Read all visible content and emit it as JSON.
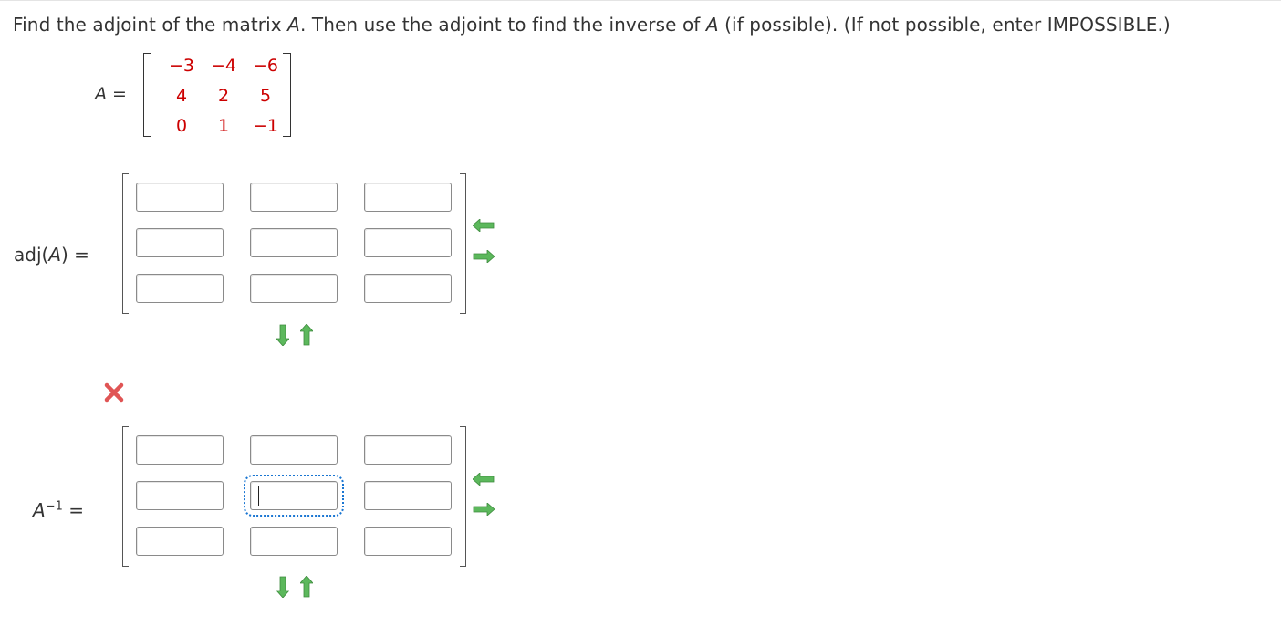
{
  "question": {
    "part1": "Find the adjoint of the matrix ",
    "var": "A",
    "part2": ". Then use the adjoint to find the inverse of ",
    "var2": "A",
    "part3": " (if possible). (If not possible, enter IMPOSSIBLE.)"
  },
  "given_matrix": {
    "label_var": "A",
    "label_eq": " =",
    "rows": [
      [
        "−3",
        "−4",
        "−6"
      ],
      [
        "4",
        "2",
        "5"
      ],
      [
        "0",
        "1",
        "−1"
      ]
    ]
  },
  "adjoint": {
    "label_pre": "adj(",
    "label_var": "A",
    "label_post": ") =",
    "cells": [
      [
        "",
        "",
        ""
      ],
      [
        "",
        "",
        ""
      ],
      [
        "",
        "",
        ""
      ]
    ]
  },
  "inverse": {
    "label_var": "A",
    "label_sup": "−1",
    "label_eq": " =",
    "cells": [
      [
        "",
        "",
        ""
      ],
      [
        "",
        "",
        ""
      ],
      [
        "",
        "",
        ""
      ]
    ],
    "status": "incorrect"
  },
  "icons": {
    "add_column": "arrow-left-icon",
    "remove_column": "arrow-right-icon",
    "add_row": "arrow-down-icon",
    "remove_row": "arrow-up-icon",
    "status": "red-x-icon"
  },
  "colors": {
    "given_entries": "#cc0000",
    "arrow": "#5cb85c",
    "x_mark": "#e05555",
    "focus": "#1a76d2"
  }
}
